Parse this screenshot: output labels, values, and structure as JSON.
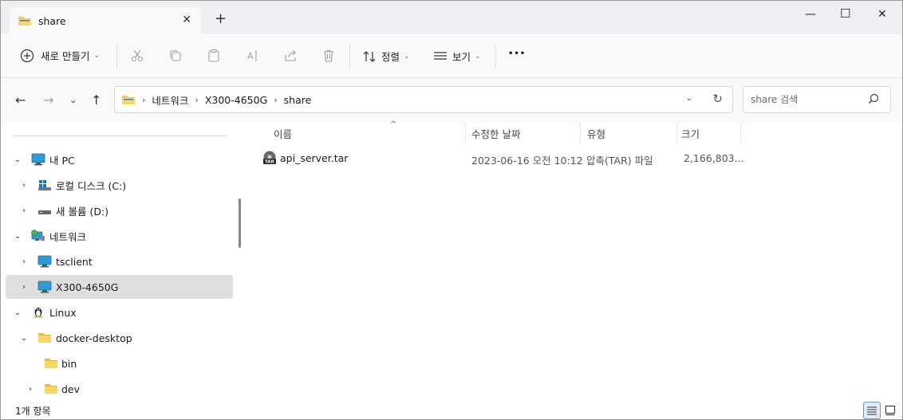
{
  "window": {
    "tab_title": "share",
    "new_tab_label": "+",
    "minimize": "—",
    "maximize": "☐",
    "close": "✕",
    "tab_close": "✕"
  },
  "toolbar": {
    "new_label": "새로 만들기",
    "sort_label": "정렬",
    "view_label": "보기",
    "more_label": "•••"
  },
  "address": {
    "crumbs": [
      "네트워크",
      "X300-4650G",
      "share"
    ]
  },
  "search": {
    "placeholder": "share 검색"
  },
  "sidebar": {
    "items": [
      {
        "label": "내 PC",
        "icon": "pc-icon",
        "expanded": true
      },
      {
        "label": "로컬 디스크 (C:)",
        "icon": "drive-c-icon",
        "expanded": false
      },
      {
        "label": "새 볼륨 (D:)",
        "icon": "drive-d-icon",
        "expanded": false
      },
      {
        "label": "네트워크",
        "icon": "network-icon",
        "expanded": true
      },
      {
        "label": "tsclient",
        "icon": "monitor-icon",
        "expanded": false
      },
      {
        "label": "X300-4650G",
        "icon": "monitor-icon",
        "expanded": false,
        "selected": true
      },
      {
        "label": "Linux",
        "icon": "linux-penguin-icon",
        "expanded": true
      },
      {
        "label": "docker-desktop",
        "icon": "folder-icon",
        "expanded": true
      },
      {
        "label": "bin",
        "icon": "folder-icon"
      },
      {
        "label": "dev",
        "icon": "folder-icon",
        "expanded": false
      }
    ]
  },
  "columns": {
    "name": "이름",
    "modified": "수정한 날짜",
    "type": "유형",
    "size": "크기"
  },
  "files": [
    {
      "name": "api_server.tar",
      "modified": "2023-06-16 오전 10:12",
      "type": "압축(TAR) 파일",
      "size": "2,166,803..."
    }
  ],
  "status": {
    "item_count": "1개 항목"
  },
  "colors": {
    "folder": "#f2c94c",
    "monitor": "#2f9bd6",
    "selected_bg": "#dfdfdf"
  }
}
